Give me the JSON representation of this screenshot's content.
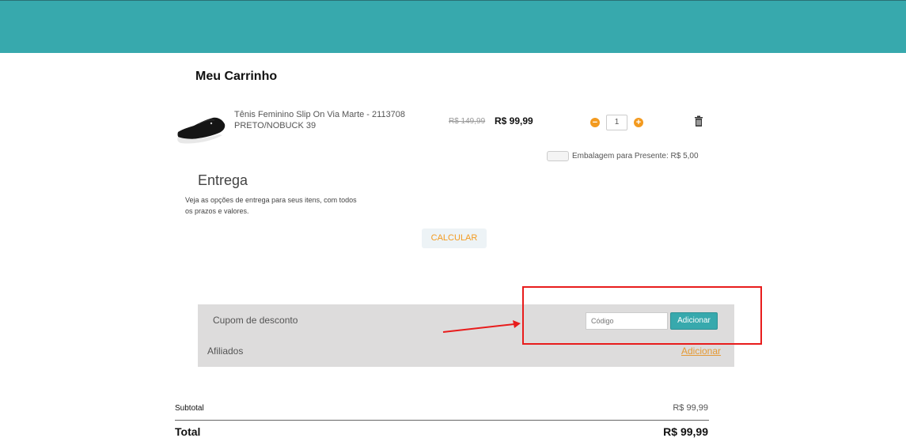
{
  "cart": {
    "title": "Meu Carrinho",
    "item": {
      "name": "Tênis Feminino Slip On Via Marte - 2113708 PRETO/NOBUCK 39",
      "price_old": "R$ 149,99",
      "price_new": "R$ 99,99",
      "quantity": "1",
      "minus_symbol": "−",
      "plus_symbol": "+",
      "image_icon": "sneaker-icon",
      "remove_icon": "trash-icon"
    },
    "gift_wrap_label": "Embalagem para Presente: R$ 5,00"
  },
  "shipping": {
    "title": "Entrega",
    "description": "Veja as opções de entrega para seus itens, com todos os prazos e valores.",
    "calculate_label": "CALCULAR"
  },
  "promo": {
    "coupon_label": "Cupom de desconto",
    "code_placeholder": "Código",
    "add_button": "Adicionar",
    "affiliates_label": "Afiliados",
    "affiliates_link": "Adicionar"
  },
  "summary": {
    "subtotal_label": "Subtotal",
    "subtotal_value": "R$ 99,99",
    "total_label": "Total",
    "total_value": "R$ 99,99"
  },
  "colors": {
    "header": "#37a9ad",
    "accent_orange": "#f39a1f",
    "annotation_red": "#e81c1c"
  }
}
